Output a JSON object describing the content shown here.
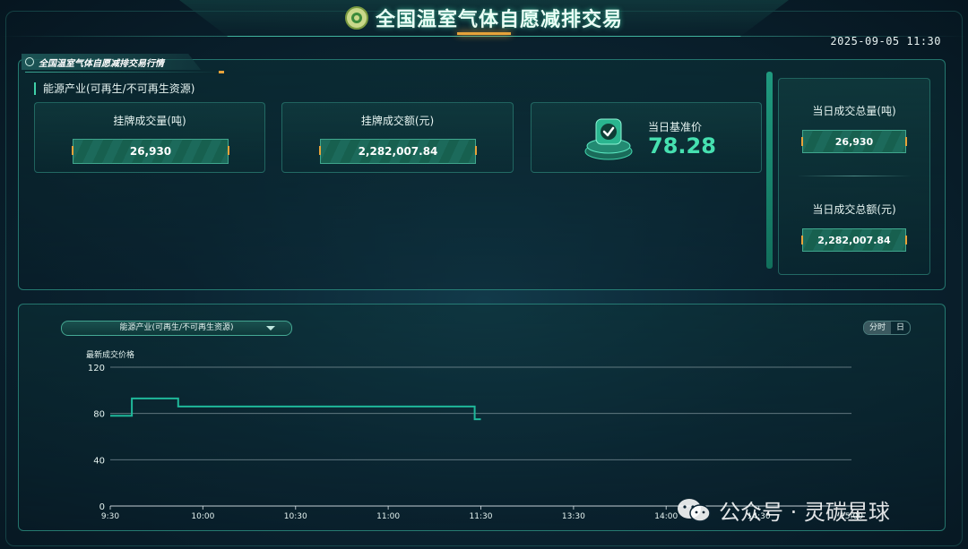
{
  "header": {
    "title": "全国温室气体自愿减排交易",
    "datetime": "2025-09-05 11:30"
  },
  "market_panel": {
    "tab_title": "全国温室气体自愿减排交易行情",
    "section_label": "能源产业(可再生/不可再生资源)",
    "cards": [
      {
        "label": "挂牌成交量(吨)",
        "value": "26,930"
      },
      {
        "label": "挂牌成交额(元)",
        "value": "2,282,007.84"
      }
    ],
    "benchmark": {
      "label": "当日基准价",
      "value": "78.28"
    },
    "daily": [
      {
        "label": "当日成交总量(吨)",
        "value": "26,930"
      },
      {
        "label": "当日成交总额(元)",
        "value": "2,282,007.84"
      }
    ]
  },
  "chart_panel": {
    "select_value": "能源产业(可再生/不可再生资源)",
    "toggle": [
      "分时",
      "日"
    ],
    "active_toggle": "分时"
  },
  "colors": {
    "accent": "#46e0b0",
    "line": "#1fb89a",
    "gold": "#e8a33a"
  },
  "chart_data": {
    "type": "line",
    "ylabel": "最新成交价格",
    "ylim": [
      0,
      120
    ],
    "yticks": [
      "0",
      "40",
      "80",
      "120"
    ],
    "xticks": [
      "9:30",
      "10:00",
      "10:30",
      "11:00",
      "11:30",
      "13:30",
      "14:00",
      "14:30",
      "15:00"
    ],
    "series": [
      {
        "step": true,
        "points": [
          [
            "9:30",
            78
          ],
          [
            "9:37",
            78
          ],
          [
            "9:37",
            93
          ],
          [
            "9:52",
            93
          ],
          [
            "9:52",
            86
          ],
          [
            "11:28",
            86
          ],
          [
            "11:28",
            75
          ],
          [
            "11:30",
            75
          ]
        ]
      }
    ],
    "grid": true
  },
  "watermark": {
    "text": "公众号 · 灵碳星球"
  }
}
